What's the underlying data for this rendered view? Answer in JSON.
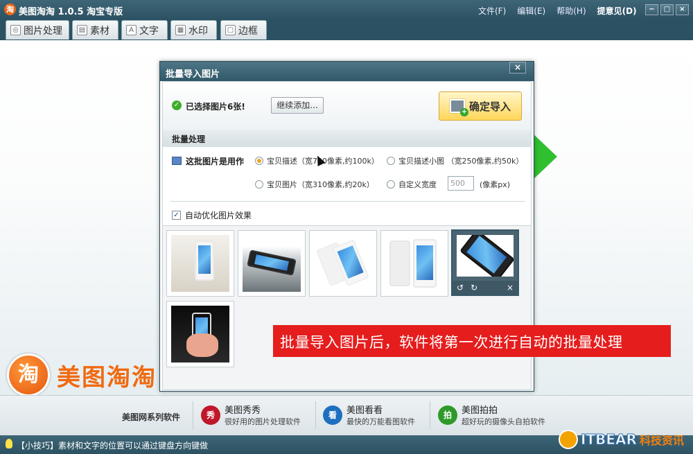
{
  "window": {
    "logo_char": "淘",
    "title": "美图淘淘 1.0.5 淘宝专版",
    "menu": [
      "文件(F)",
      "编辑(E)",
      "帮助(H)"
    ],
    "feedback": "提意见(D)",
    "controls": [
      "−",
      "□",
      "×"
    ]
  },
  "tabs": [
    {
      "label": "图片处理",
      "icon": "picture-icon"
    },
    {
      "label": "素材",
      "icon": "material-icon"
    },
    {
      "label": "文字",
      "icon": "text-icon",
      "icon_char": "A"
    },
    {
      "label": "水印",
      "icon": "watermark-icon"
    },
    {
      "label": "边框",
      "icon": "border-icon"
    }
  ],
  "dialog": {
    "title": "批量导入图片",
    "close": "×",
    "selected_text": "已选择图片6张!",
    "continue_btn": "继续添加...",
    "import_btn": "确定导入",
    "batch_header": "批量处理",
    "usage_label": "这批图片是用作",
    "options": [
      {
        "label": "宝贝描述（宽700像素,约100k）",
        "selected": true
      },
      {
        "label": "宝贝描述小图  （宽250像素,约50k）",
        "selected": false
      },
      {
        "label": "宝贝图片（宽310像素,约20k）",
        "selected": false
      },
      {
        "label": "自定义宽度",
        "selected": false
      }
    ],
    "custom_width_value": "500",
    "custom_width_unit": "(像素px)",
    "auto_optimize": {
      "label": "自动优化图片效果",
      "checked": true,
      "check_char": "✓"
    },
    "thumb_controls": [
      "↺",
      "↻",
      "×"
    ]
  },
  "caption": "批量导入图片后，软件将第一次进行自动的批量处理",
  "brand": {
    "logo_char": "淘",
    "name": "美图淘淘"
  },
  "footer": {
    "series_label": "美图网系列软件",
    "products": [
      {
        "icon_char": "秀",
        "name": "美图秀秀",
        "desc": "很好用的图片处理软件",
        "color": "#c0182a"
      },
      {
        "icon_char": "看",
        "name": "美图看看",
        "desc": "最快的万能看图软件",
        "color": "#1f6fc0"
      },
      {
        "icon_char": "拍",
        "name": "美图拍拍",
        "desc": "超好玩的摄像头自拍软件",
        "color": "#2f9a2a"
      }
    ]
  },
  "status": {
    "tip": "【小技巧】素材和文字的位置可以通过键盘方向键做"
  },
  "watermark": {
    "latin": "ITBEAR",
    "cn": "科技资讯"
  },
  "colors": {
    "accent_green": "#2fbf2f",
    "caption_red": "#e51d1d",
    "brand_orange": "#f06a10"
  }
}
